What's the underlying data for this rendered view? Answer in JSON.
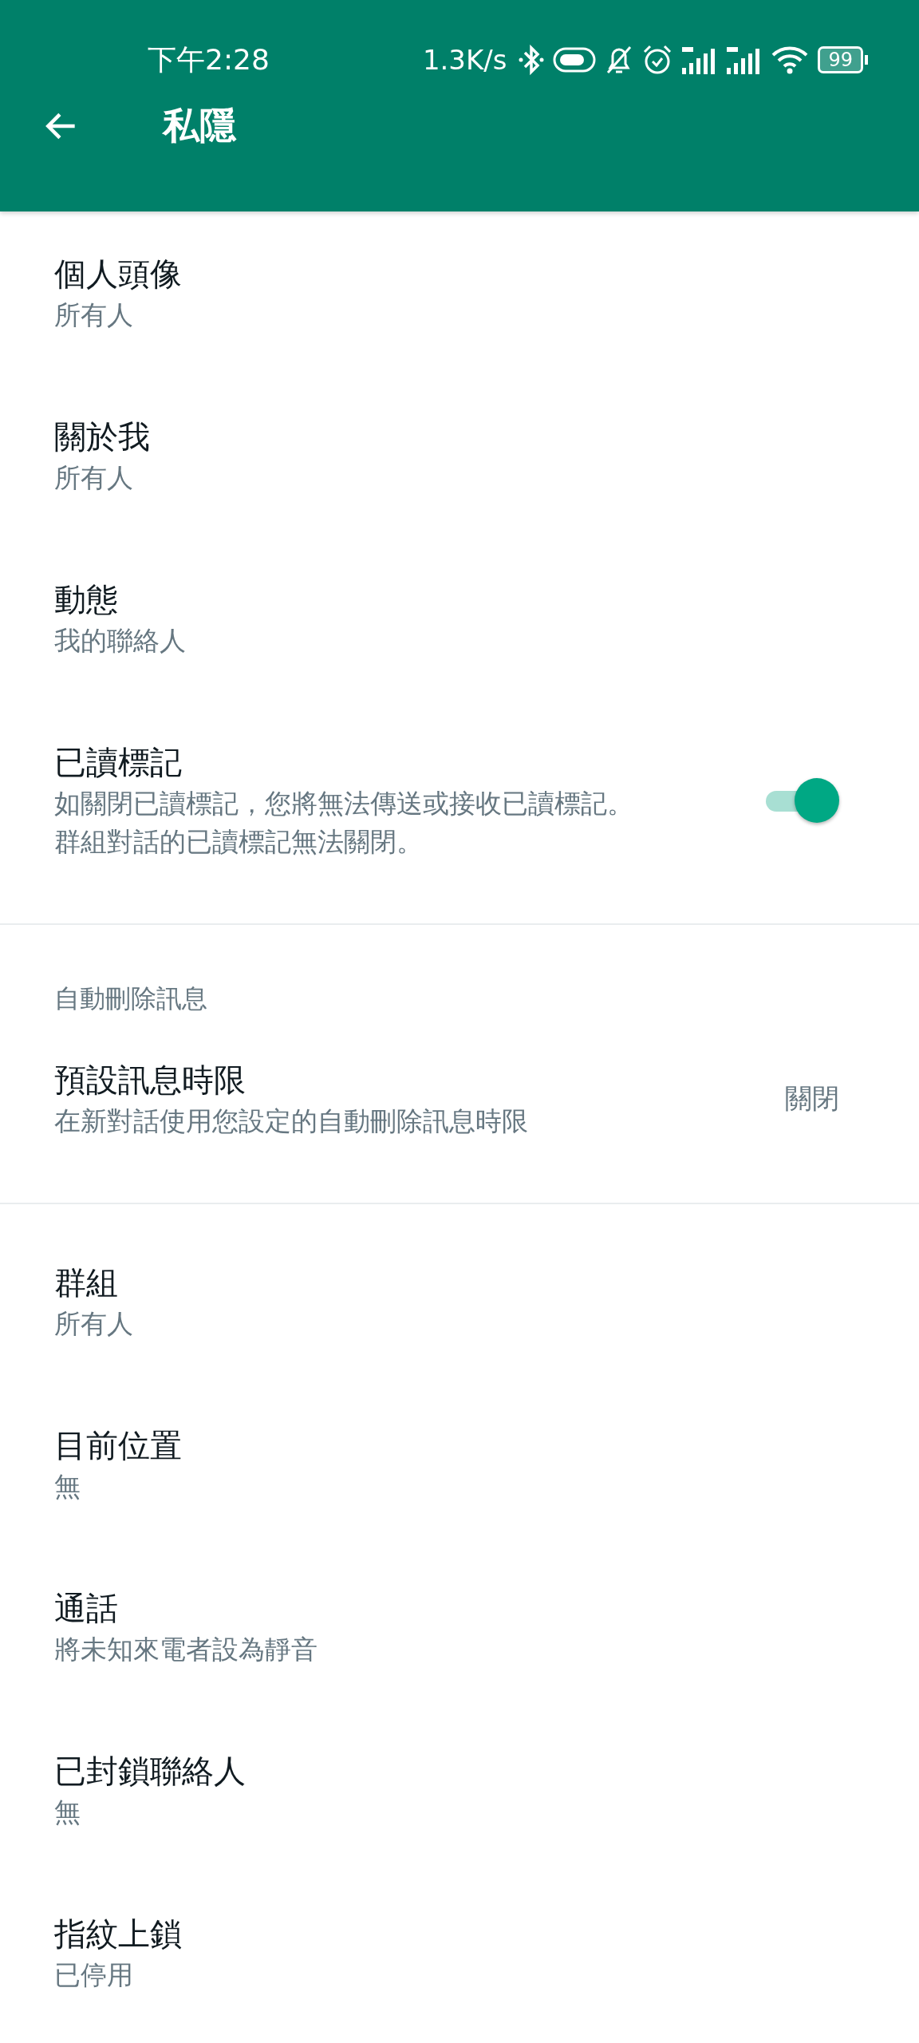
{
  "status_bar": {
    "time": "下午2:28",
    "network_speed": "1.3K/s",
    "battery": "99"
  },
  "app_bar": {
    "title": "私隱"
  },
  "sections": [
    {
      "items": [
        {
          "kind": "text",
          "title": "個人頭像",
          "subtitle": "所有人"
        },
        {
          "kind": "text",
          "title": "關於我",
          "subtitle": "所有人"
        },
        {
          "kind": "text",
          "title": "動態",
          "subtitle": "我的聯絡人"
        },
        {
          "kind": "toggle",
          "title": "已讀標記",
          "subtitle": "如關閉已讀標記，您將無法傳送或接收已讀標記。群組對話的已讀標記無法關閉。",
          "on": true
        }
      ]
    },
    {
      "header": "自動刪除訊息",
      "items": [
        {
          "kind": "value",
          "title": "預設訊息時限",
          "subtitle": "在新對話使用您設定的自動刪除訊息時限",
          "value": "關閉"
        }
      ]
    },
    {
      "items": [
        {
          "kind": "text",
          "title": "群組",
          "subtitle": "所有人"
        },
        {
          "kind": "text",
          "title": "目前位置",
          "subtitle": "無"
        },
        {
          "kind": "text",
          "title": "通話",
          "subtitle": "將未知來電者設為靜音"
        },
        {
          "kind": "text",
          "title": "已封鎖聯絡人",
          "subtitle": "無"
        },
        {
          "kind": "text",
          "title": "指紋上鎖",
          "subtitle": "已停用"
        }
      ]
    }
  ]
}
